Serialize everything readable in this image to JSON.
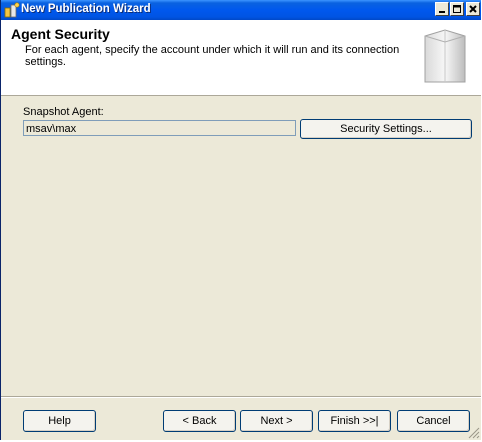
{
  "window": {
    "title": "New Publication Wizard",
    "title_color": "#0054e3",
    "background": "#ece9d8"
  },
  "header": {
    "title": "Agent Security",
    "description": "For each agent, specify the account under which it will run and its connection settings."
  },
  "snapshot_agent": {
    "label": "Snapshot Agent:",
    "account": "msav\\max",
    "button_label": "Security Settings..."
  },
  "footer": {
    "help_label": "Help",
    "back_label": "< Back",
    "next_label": "Next >",
    "finish_label": "Finish >>|",
    "cancel_label": "Cancel"
  },
  "icons": {
    "app": "wizard-app-icon",
    "minimize": "minimize-icon",
    "maximize": "maximize-icon",
    "close": "close-icon",
    "header": "server-graphic",
    "resize": "resize-grip-icon"
  }
}
